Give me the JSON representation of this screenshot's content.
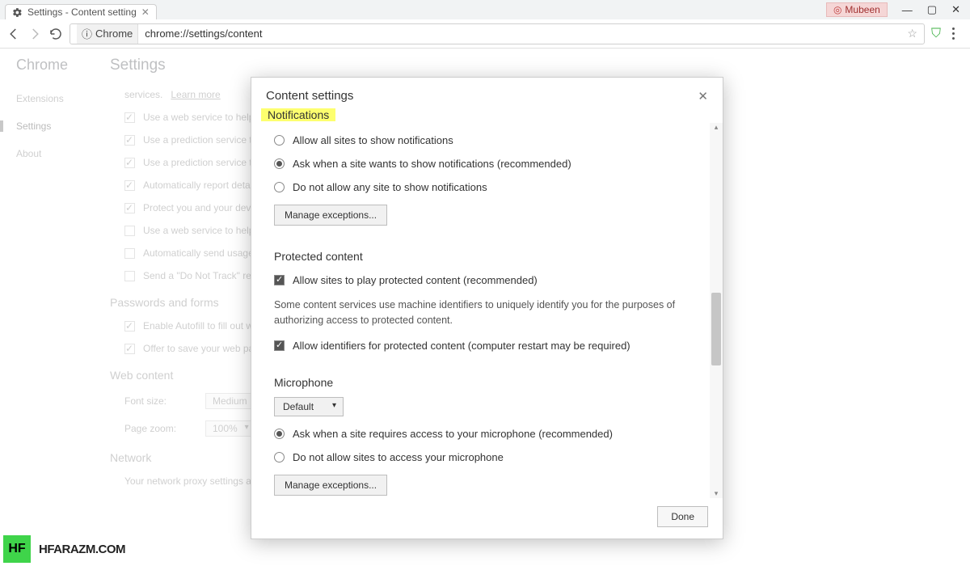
{
  "window": {
    "tab_title": "Settings - Content setting",
    "profile_name": "Mubeen"
  },
  "address": {
    "security_chip": "Chrome",
    "url": "chrome://settings/content"
  },
  "sidebar": {
    "brand": "Chrome",
    "items": [
      {
        "label": "Extensions",
        "selected": false
      },
      {
        "label": "Settings",
        "selected": true
      },
      {
        "label": "About",
        "selected": false
      }
    ]
  },
  "settings_page": {
    "title": "Settings",
    "intro_fragment": "services.",
    "learn_more": "Learn more",
    "privacy_checks": [
      {
        "checked": true,
        "label": "Use a web service to help res"
      },
      {
        "checked": true,
        "label": "Use a prediction service to he"
      },
      {
        "checked": true,
        "label": "Use a prediction service to lo"
      },
      {
        "checked": true,
        "label": "Automatically report details o"
      },
      {
        "checked": true,
        "label": "Protect you and your device f"
      },
      {
        "checked": false,
        "label": "Use a web service to help res"
      },
      {
        "checked": false,
        "label": "Automatically send usage sta"
      },
      {
        "checked": false,
        "label": "Send a \"Do Not Track\" reques"
      }
    ],
    "pw_head": "Passwords and forms",
    "pw_checks": [
      {
        "checked": true,
        "label": "Enable Autofill to fill out web"
      },
      {
        "checked": true,
        "label": "Offer to save your web passw"
      }
    ],
    "web_head": "Web content",
    "font_label": "Font size:",
    "font_value": "Medium",
    "zoom_label": "Page zoom:",
    "zoom_value": "100%",
    "network_head": "Network",
    "network_desc": "Your network proxy settings are b"
  },
  "dialog": {
    "title": "Content settings",
    "notifications": {
      "head": "Notifications",
      "opts": [
        "Allow all sites to show notifications",
        "Ask when a site wants to show notifications (recommended)",
        "Do not allow any site to show notifications"
      ],
      "selected": 1,
      "manage": "Manage exceptions..."
    },
    "protected": {
      "head": "Protected content",
      "check1": "Allow sites to play protected content (recommended)",
      "desc": "Some content services use machine identifiers to uniquely identify you for the purposes of authorizing access to protected content.",
      "check2": "Allow identifiers for protected content (computer restart may be required)"
    },
    "microphone": {
      "head": "Microphone",
      "select": "Default",
      "opts": [
        "Ask when a site requires access to your microphone (recommended)",
        "Do not allow sites to access your microphone"
      ],
      "selected": 0,
      "manage": "Manage exceptions..."
    },
    "done": "Done"
  },
  "watermark": {
    "logo": "HF",
    "text": "HFARAZM.COM"
  }
}
